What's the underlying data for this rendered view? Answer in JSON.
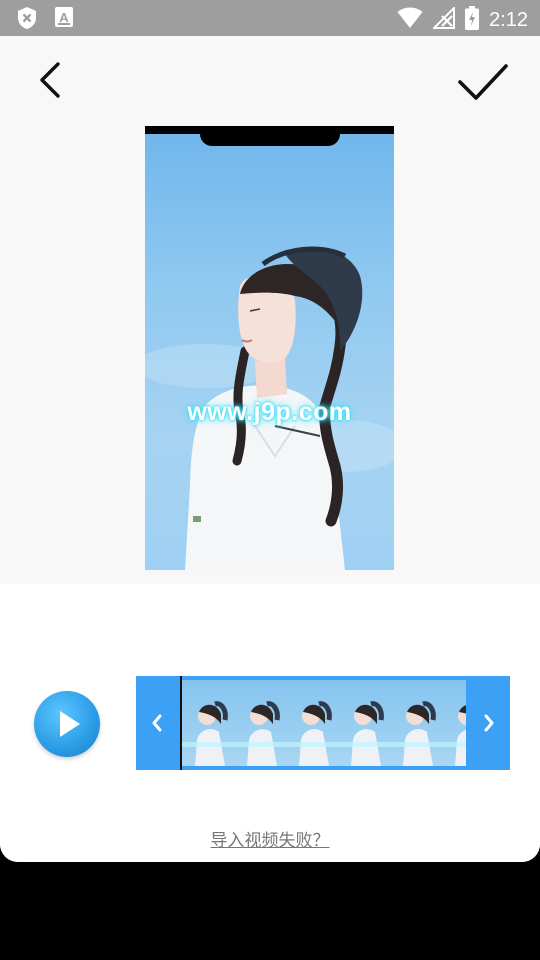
{
  "status_bar": {
    "time": "2:12",
    "icons": [
      "close-badge-icon",
      "font-a-icon",
      "wifi-icon",
      "signal-off-icon",
      "battery-charging-icon"
    ]
  },
  "toolbar": {
    "back_icon": "chevron-left-icon",
    "confirm_icon": "checkmark-icon"
  },
  "preview": {
    "watermark": "www.j9p.com"
  },
  "player": {
    "play_icon": "play-icon"
  },
  "timeline": {
    "frame_count": 6,
    "left_handle_icon": "chevron-left-icon",
    "right_handle_icon": "chevron-right-icon",
    "accent_color": "#3ca0f5"
  },
  "footer": {
    "import_failed_link": "导入视频失败？"
  }
}
